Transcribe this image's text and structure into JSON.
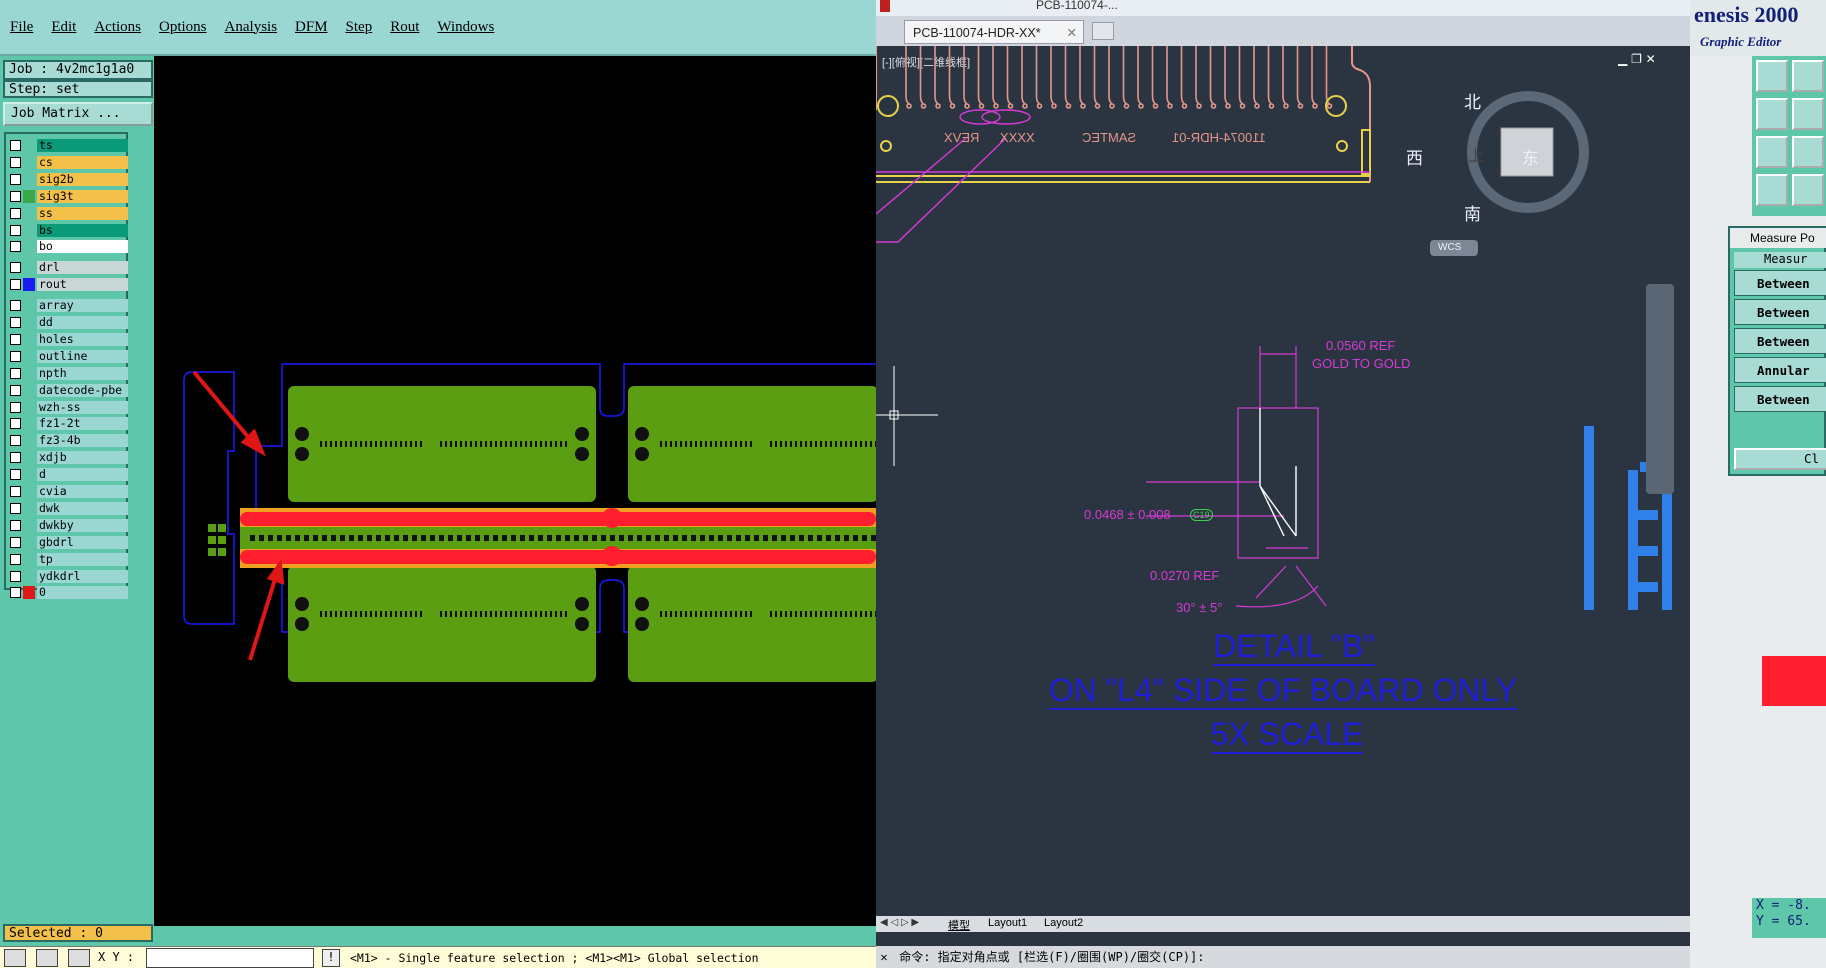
{
  "genesis": {
    "menu": [
      "File",
      "Edit",
      "Actions",
      "Options",
      "Analysis",
      "DFM",
      "Step",
      "Rout",
      "Windows"
    ],
    "job_label": "Job : 4v2mc1g1a0",
    "step_label": "Step: set",
    "job_matrix_button": "Job Matrix ...",
    "layers": [
      {
        "name": "ts",
        "color": "#0a9a78"
      },
      {
        "name": "cs",
        "color": "#f3c14a"
      },
      {
        "name": "sig2b",
        "color": "#f3c14a"
      },
      {
        "name": "sig3t",
        "color": "#f3c14a",
        "swatch": "#39a84a"
      },
      {
        "name": "ss",
        "color": "#f3c14a"
      },
      {
        "name": "bs",
        "color": "#0a9a78"
      },
      {
        "name": "bo",
        "color": "#ffffff"
      },
      {
        "name": "drl",
        "color": "#c9d6d6"
      },
      {
        "name": "rout",
        "color": "#c9d6d6",
        "swatch": "#1c1cf2"
      },
      {
        "name": "array",
        "color": "#9ad6d2"
      },
      {
        "name": "dd",
        "color": "#9ad6d2"
      },
      {
        "name": "holes",
        "color": "#9ad6d2"
      },
      {
        "name": "outline",
        "color": "#9ad6d2"
      },
      {
        "name": "npth",
        "color": "#9ad6d2"
      },
      {
        "name": "datecode-pbe",
        "color": "#9ad6d2"
      },
      {
        "name": "wzh-ss",
        "color": "#9ad6d2"
      },
      {
        "name": "fz1-2t",
        "color": "#9ad6d2"
      },
      {
        "name": "fz3-4b",
        "color": "#9ad6d2"
      },
      {
        "name": "xdjb",
        "color": "#9ad6d2"
      },
      {
        "name": "d",
        "color": "#9ad6d2"
      },
      {
        "name": "cvia",
        "color": "#9ad6d2"
      },
      {
        "name": "dwk",
        "color": "#9ad6d2"
      },
      {
        "name": "dwkby",
        "color": "#9ad6d2"
      },
      {
        "name": "gbdrl",
        "color": "#9ad6d2"
      },
      {
        "name": "tp",
        "color": "#9ad6d2"
      },
      {
        "name": "ydkdrl",
        "color": "#9ad6d2"
      },
      {
        "name": "0",
        "color": "#9ad6d2",
        "swatch": "#e01818"
      }
    ],
    "selected_label": "Selected : 0",
    "xy_label": "X Y :",
    "hint": "<M1> - Single feature selection ; <M1><M1> Global selection"
  },
  "cad": {
    "title_fragment": "PCB-110074-...",
    "tab_label": "PCB-110074-HDR-XX*",
    "viewport_label": "[-][俯视][二维线框]",
    "compass": {
      "n": "北",
      "s": "南",
      "e": "东",
      "w": "西",
      "center": "上",
      "wcs": "WCS"
    },
    "silk_texts": [
      "REVX",
      "XXXX",
      "SAMTEC",
      "110074-HDR-01"
    ],
    "dims": {
      "d1_a": "0.0560 REF",
      "d1_b": "GOLD TO GOLD",
      "d2": "0.0468 ± 0.008",
      "d2_tag": "C19",
      "d3": "0.0270 REF",
      "d4": "30° ± 5°"
    },
    "detail": [
      "DETAIL \"B\"",
      "ON \"L4\" SIDE OF BOARD ONLY",
      "5X SCALE"
    ],
    "layout_tabs": [
      "模型",
      "Layout1",
      "Layout2"
    ],
    "command": "命令: 指定对角点或 [栏选(F)/圈围(WP)/圈交(CP)]:"
  },
  "right": {
    "title": "enesis 2000",
    "subtitle": "Graphic Editor",
    "measure_title": "Measure Po",
    "measure_head": "Measur",
    "measure_items": [
      "Between",
      "Between",
      "Between",
      "Annular",
      "Between"
    ],
    "close": "Cl",
    "xy": [
      "X = -8.",
      "Y = 65."
    ]
  }
}
